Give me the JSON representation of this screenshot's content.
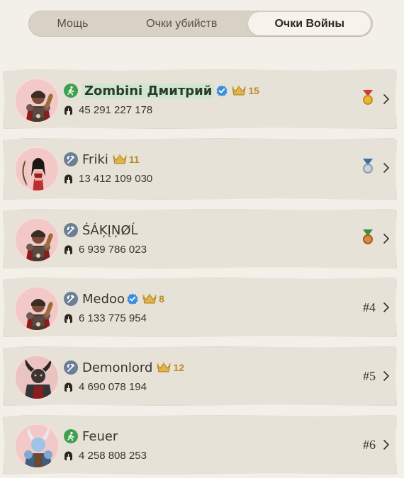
{
  "tabs": [
    {
      "label": "Мощь",
      "active": false
    },
    {
      "label": "Очки убийств",
      "active": false
    },
    {
      "label": "Очки Войны",
      "active": true
    }
  ],
  "players": [
    {
      "name": "Zombini Дмитрий",
      "highlight": true,
      "class_icon": "runner-icon",
      "class_color": "#3fa14f",
      "verified": true,
      "crown": "15",
      "power": "45 291 227 178",
      "rank_text": "",
      "medal": "gold-medal-icon",
      "avatar": "warrior-red-cape"
    },
    {
      "name": "Friki",
      "highlight": false,
      "class_icon": "axe-icon",
      "class_color": "#6d7f95",
      "verified": false,
      "crown": "11",
      "power": "13 412 109 030",
      "rank_text": "",
      "medal": "silver-medal-icon",
      "avatar": "female-archer"
    },
    {
      "name": "ŚÁĶĮŅØĹ",
      "highlight": false,
      "class_icon": "axe-icon",
      "class_color": "#6d7f95",
      "verified": false,
      "crown": "",
      "power": "6 939 786 023",
      "rank_text": "",
      "medal": "bronze-medal-icon",
      "avatar": "warrior-red-cape"
    },
    {
      "name": "Medoo",
      "highlight": false,
      "class_icon": "axe-icon",
      "class_color": "#6d7f95",
      "verified": true,
      "crown": "8",
      "power": "6 133 775 954",
      "rank_text": "#4",
      "medal": "",
      "avatar": "warrior-red-cape"
    },
    {
      "name": "Demonlord",
      "highlight": false,
      "class_icon": "axe-icon",
      "class_color": "#6d7f95",
      "verified": false,
      "crown": "12",
      "power": "4 690 078 194",
      "rank_text": "#5",
      "medal": "",
      "avatar": "horned-dark-warrior"
    },
    {
      "name": "Feuer",
      "highlight": false,
      "class_icon": "runner-icon",
      "class_color": "#3fa14f",
      "verified": false,
      "crown": "",
      "power": "4 258 808 253",
      "rank_text": "#6",
      "medal": "",
      "avatar": "blue-horned-warrior"
    }
  ],
  "colors": {
    "accent_green": "#3fa14f",
    "crown_gold": "#b98b2a",
    "verified_blue": "#3b8fe0"
  }
}
